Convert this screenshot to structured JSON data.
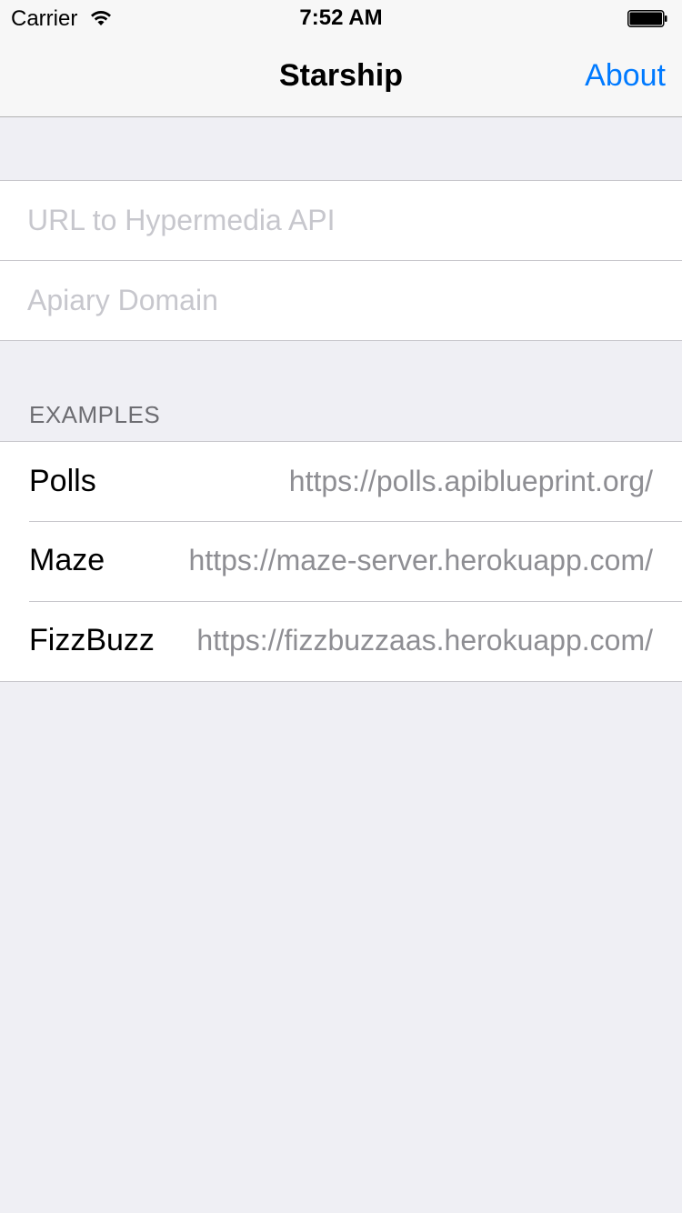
{
  "status_bar": {
    "carrier": "Carrier",
    "time": "7:52 AM",
    "wifi_icon": "wifi-icon",
    "battery_icon": "battery-icon",
    "battery_level": 1.0
  },
  "nav": {
    "title": "Starship",
    "about_label": "About",
    "accent_color": "#007aff"
  },
  "form": {
    "url_placeholder": "URL to Hypermedia API",
    "url_value": "",
    "apiary_placeholder": "Apiary Domain",
    "apiary_value": ""
  },
  "examples": {
    "header": "EXAMPLES",
    "items": [
      {
        "name": "Polls",
        "url": "https://polls.apiblueprint.org/"
      },
      {
        "name": "Maze",
        "url": "https://maze-server.herokuapp.com/"
      },
      {
        "name": "FizzBuzz",
        "url": "https://fizzbuzzaas.herokuapp.com/"
      }
    ]
  }
}
